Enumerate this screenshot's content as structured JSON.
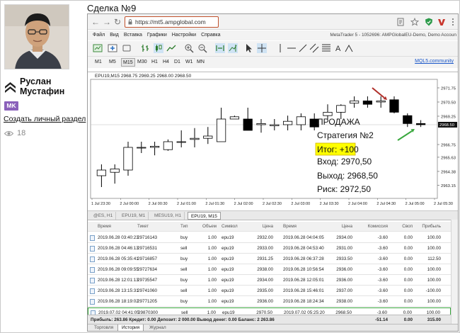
{
  "profile": {
    "name_line1": "Руслан",
    "name_line2": "Мустафин",
    "badge": "MK",
    "create_link": "Создать личный раздел",
    "views": "18"
  },
  "post_title": "Сделка №9",
  "browser": {
    "url": "https://mt5.ampglobal.com"
  },
  "menu": [
    "Файл",
    "Вид",
    "Вставка",
    "Графики",
    "Настройки",
    "Справка"
  ],
  "mt5_title": "MetaTrader 5 - 1052696: AMPGlobalEU-Demo, Demo Accoun",
  "timeframes": [
    "M1",
    "M5",
    "M15",
    "M30",
    "H1",
    "H4",
    "D1",
    "W1",
    "MN"
  ],
  "active_timeframe": "M15",
  "mql_link": "MQL5.community",
  "chart": {
    "header": "EPU19,M15  2968.75 2969.25 2968.00 2968.50",
    "y_ticks": [
      "2971.75",
      "2970.50",
      "2969.25",
      "2966.75",
      "2965.63",
      "2964.38",
      "2963.15"
    ],
    "price_label": "2968.50",
    "x_ticks": [
      "1 Jul 23:30",
      "2 Jul 00:00",
      "2 Jul 00:30",
      "2 Jul 01:00",
      "2 Jul 01:30",
      "2 Jul 02:00",
      "2 Jul 02:30",
      "2 Jul 03:00",
      "2 Jul 03:30",
      "2 Jul 04:00",
      "2 Jul 04:30",
      "2 Jul 05:00",
      "2 Jul 05:30"
    ],
    "candles": [
      {
        "o": 2964.0,
        "h": 2965.0,
        "l": 2963.0,
        "c": 2964.5
      },
      {
        "o": 2964.3,
        "h": 2965.0,
        "l": 2963.3,
        "c": 2964.6
      },
      {
        "o": 2964.5,
        "h": 2967.0,
        "l": 2964.0,
        "c": 2966.5
      },
      {
        "o": 2966.5,
        "h": 2967.0,
        "l": 2966.0,
        "c": 2966.5
      },
      {
        "o": 2966.5,
        "h": 2967.0,
        "l": 2965.8,
        "c": 2966.6
      },
      {
        "o": 2966.3,
        "h": 2967.2,
        "l": 2966.2,
        "c": 2967.0
      },
      {
        "o": 2967.0,
        "h": 2968.0,
        "l": 2966.5,
        "c": 2967.0
      },
      {
        "o": 2967.2,
        "h": 2968.2,
        "l": 2966.5,
        "c": 2967.3
      },
      {
        "o": 2967.3,
        "h": 2968.3,
        "l": 2966.8,
        "c": 2967.5
      },
      {
        "o": 2967.0,
        "h": 2970.0,
        "l": 2967.0,
        "c": 2969.0
      },
      {
        "o": 2969.0,
        "h": 2969.3,
        "l": 2969.0,
        "c": 2969.2
      },
      {
        "o": 2969.0,
        "h": 2970.0,
        "l": 2968.5,
        "c": 2968.0
      },
      {
        "o": 2968.5,
        "h": 2969.0,
        "l": 2967.8,
        "c": 2968.6
      },
      {
        "o": 2968.4,
        "h": 2969.0,
        "l": 2968.0,
        "c": 2968.5
      },
      {
        "o": 2968.5,
        "h": 2969.3,
        "l": 2968.0,
        "c": 2968.8
      },
      {
        "o": 2968.5,
        "h": 2969.5,
        "l": 2968.0,
        "c": 2969.2
      },
      {
        "o": 2969.0,
        "h": 2969.5,
        "l": 2968.0,
        "c": 2968.3
      },
      {
        "o": 2969.3,
        "h": 2970.3,
        "l": 2969.0,
        "c": 2969.6
      },
      {
        "o": 2969.6,
        "h": 2970.3,
        "l": 2969.0,
        "c": 2970.2
      },
      {
        "o": 2970.4,
        "h": 2971.0,
        "l": 2970.0,
        "c": 2970.6
      },
      {
        "o": 2970.6,
        "h": 2971.0,
        "l": 2970.0,
        "c": 2970.3
      },
      {
        "o": 2970.5,
        "h": 2971.0,
        "l": 2970.0,
        "c": 2970.6
      },
      {
        "o": 2970.7,
        "h": 2971.0,
        "l": 2969.5,
        "c": 2969.6
      },
      {
        "o": 2969.3,
        "h": 2969.5,
        "l": 2968.3,
        "c": 2968.6
      },
      {
        "o": 2968.6,
        "h": 2968.9,
        "l": 2968.3,
        "c": 2968.5
      }
    ],
    "annotation": {
      "line1": "ПРОДАЖА",
      "line2": "Стратегия №2",
      "result": "Итог: +100",
      "entry": "Вход: 2970,50",
      "exit": "Выход: 2968,50",
      "risk": "Риск: 2972,50"
    }
  },
  "chart_tabs": [
    "@ES, H1",
    "EPU19, M1",
    "MESU19, H1",
    "EPU19, M15"
  ],
  "active_chart_tab": "EPU19, M15",
  "history": {
    "columns": [
      "Время",
      "Тикет",
      "Тип",
      "Объем",
      "Символ",
      "Цена",
      "Время",
      "Цена",
      "Комиссия",
      "Своп",
      "Прибыль"
    ],
    "rows": [
      [
        "2019.06.28 03:40:23",
        "29716143",
        "buy",
        "1.00",
        "epu19",
        "2932.00",
        "2019.06.28 04:04:05",
        "2934.00",
        "-3.60",
        "0.00",
        "100.00"
      ],
      [
        "2019.06.28 04:46:13",
        "29716531",
        "sell",
        "1.00",
        "epu19",
        "2933.00",
        "2019.06.28 04:53:40",
        "2931.00",
        "-3.60",
        "0.00",
        "100.00"
      ],
      [
        "2019.06.28 05:35:41",
        "29716857",
        "buy",
        "1.00",
        "epu19",
        "2931.25",
        "2019.06.28 06:37:28",
        "2933.50",
        "-3.60",
        "0.00",
        "112.50"
      ],
      [
        "2019.06.28 09:09:55",
        "29727634",
        "sell",
        "1.00",
        "epu19",
        "2938.00",
        "2019.06.28 10:56:54",
        "2936.00",
        "-3.60",
        "0.00",
        "100.00"
      ],
      [
        "2019.06.28 12:01:13",
        "29735547",
        "buy",
        "1.00",
        "epu19",
        "2934.00",
        "2019.06.28 12:05:01",
        "2936.00",
        "-3.60",
        "0.00",
        "100.00"
      ],
      [
        "2019.06.28 13:15:31",
        "29741060",
        "sell",
        "1.00",
        "epu19",
        "2935.00",
        "2019.06.28 15:46:01",
        "2937.00",
        "-3.60",
        "0.00",
        "-100.00"
      ],
      [
        "2019.06.28 18:19:02",
        "29771205",
        "buy",
        "1.00",
        "epu19",
        "2936.00",
        "2019.06.28 18:24:34",
        "2938.00",
        "-3.60",
        "0.00",
        "100.00"
      ],
      [
        "2019.07.02 04:41:05",
        "29870300",
        "sell",
        "1.00",
        "epu19",
        "2970.50",
        "2019.07.02 05:25:20",
        "2968.50",
        "-3.60",
        "0.00",
        "100.00"
      ]
    ],
    "highlighted_row": 7,
    "summary": {
      "text": "Прибыль: 263.86  Кредит: 0.00  Депозит: 2 000.00  Вывод денег: 0.00  Баланс: 2 263.86",
      "commission": "-51.14",
      "swap": "0.00",
      "profit": "315.00"
    }
  },
  "bottom_tabs": [
    "Торговля",
    "История",
    "Журнал"
  ],
  "active_bottom_tab": "История",
  "colors": {
    "badge": "#8a60ba",
    "url_border": "#c0512c",
    "result_highlight": "#ffff00",
    "arrow_red": "#b0302a",
    "arrow_green": "#3aa83e",
    "highlight_row": "#35a43a",
    "link": "#1a57c9"
  }
}
